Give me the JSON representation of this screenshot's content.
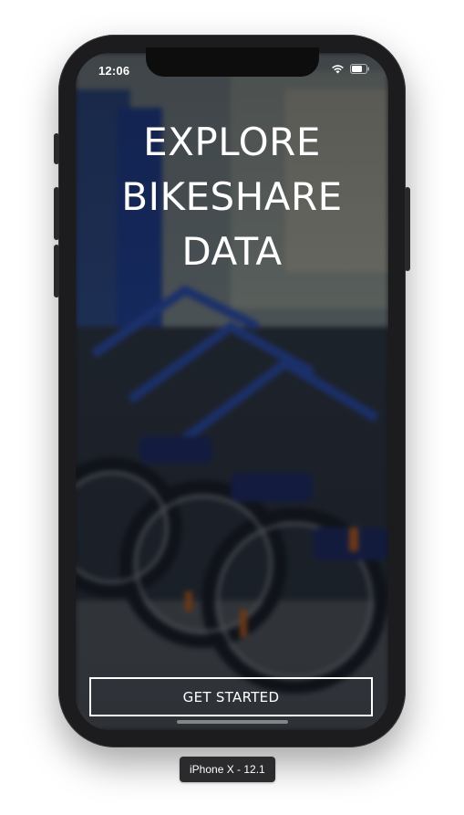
{
  "status_bar": {
    "time": "12:06",
    "wifi_icon": "wifi-icon",
    "battery_icon": "battery-icon"
  },
  "hero": {
    "title": "EXPLORE\nBIKESHARE\nDATA",
    "background_image": "bikeshare-bikes-photo"
  },
  "actions": {
    "get_started_label": "GET STARTED"
  },
  "simulator": {
    "device_label": "iPhone X - 12.1"
  },
  "colors": {
    "text": "#ffffff",
    "button_border": "#ffffff",
    "device_frame": "#1c1c1e",
    "bike_blue": "#1a3a9a"
  }
}
